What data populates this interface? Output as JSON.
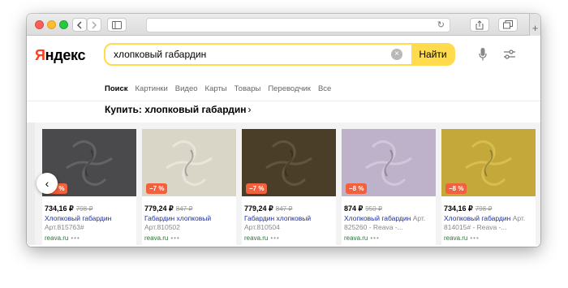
{
  "browser": {
    "back_icon": "chevron-left-icon",
    "forward_icon": "chevron-right-icon",
    "sidebar_icon": "sidebar-icon",
    "reload_icon": "reload-icon",
    "share_icon": "share-icon",
    "tabs_icon": "tabs-icon",
    "new_tab": "+"
  },
  "header": {
    "logo_first": "Я",
    "logo_rest": "ндекс",
    "search_value": "хлопковый габардин",
    "search_button": "Найти",
    "clear_icon": "×",
    "tabs": [
      "Поиск",
      "Картинки",
      "Видео",
      "Карты",
      "Товары",
      "Переводчик",
      "Все"
    ]
  },
  "section": {
    "title": "Купить: хлопковый габардин",
    "chevron": "›",
    "prev_arrow": "‹"
  },
  "products": [
    {
      "color": "#4a4a4c",
      "highlight": "#6a6a6c",
      "badge": "−7 %",
      "price": "734,16 ₽",
      "old_price": "798 ₽",
      "title": "Хлопковый габардин",
      "title_gray": "Арт.815763#",
      "shop": "reava.ru"
    },
    {
      "color": "#d9d6c8",
      "highlight": "#ecebe0",
      "badge": "−7 %",
      "price": "779,24 ₽",
      "old_price": "847 ₽",
      "title": "Габардин хлопковый",
      "title_gray": "Арт.810502",
      "shop": "reava.ru"
    },
    {
      "color": "#4b3e29",
      "highlight": "#6a5a40",
      "badge": "−7 %",
      "price": "779,24 ₽",
      "old_price": "847 ₽",
      "title": "Габардин хлопковый",
      "title_gray": "Арт.810504",
      "shop": "reava.ru"
    },
    {
      "color": "#bdb2c9",
      "highlight": "#d6cde0",
      "badge": "−8 %",
      "price": "874 ₽",
      "old_price": "950 ₽",
      "title": "Хлопковый габардин",
      "title_gray": "Арт. 825260 - Reava -...",
      "shop": "reava.ru"
    },
    {
      "color": "#c4a93a",
      "highlight": "#dcc458",
      "badge": "−8 %",
      "price": "734,16 ₽",
      "old_price": "798 ₽",
      "title": "Хлопковый габардин",
      "title_gray": "Арт. 814015# - Reava -...",
      "shop": "reava.ru"
    }
  ],
  "more_dots": "•••"
}
